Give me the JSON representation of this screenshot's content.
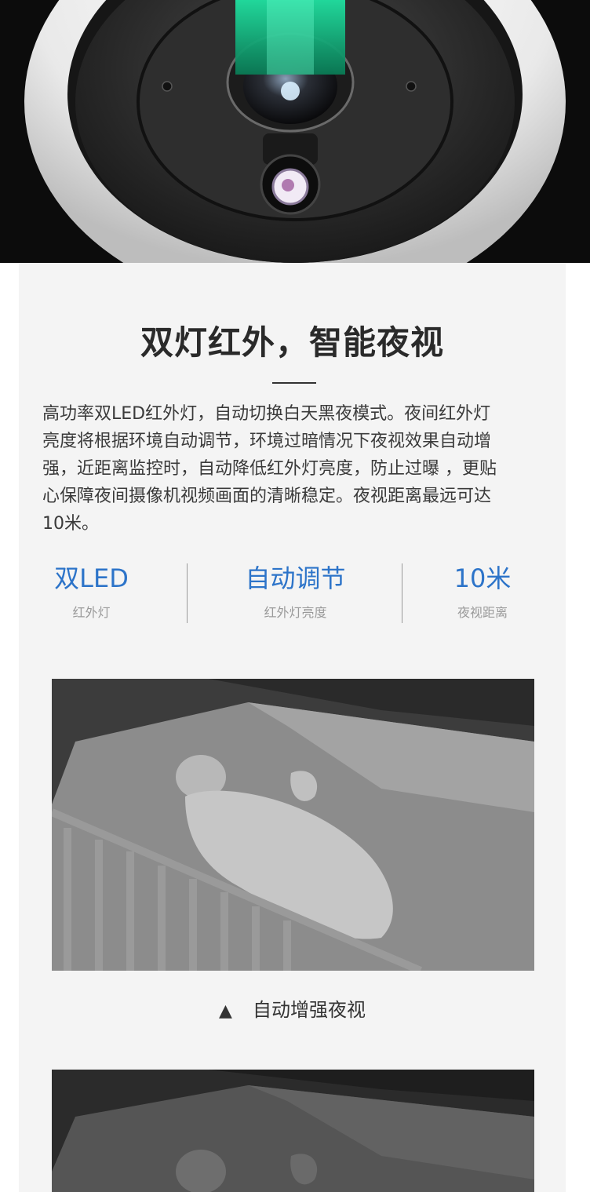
{
  "section": {
    "title": "双灯红外，智能夜视",
    "description_lines": [
      "高功率双LED红外灯，自动切换白天黑夜模式。夜间红外灯",
      "亮度将根据环境自动调节，环境过暗情况下夜视效果自动增",
      "强，近距离监控时，自动降低红外灯亮度，防止过曝 ，更贴",
      "心保障夜间摄像机视频画面的清晰稳定。夜视距离最远可达",
      "10米。"
    ]
  },
  "features": [
    {
      "value": "双LED",
      "label": "红外灯"
    },
    {
      "value": "自动调节",
      "label": "红外灯亮度"
    },
    {
      "value": "10米",
      "label": "夜视距离"
    }
  ],
  "caption": {
    "icon": "triangle-up-icon",
    "text": "自动增强夜视"
  },
  "colors": {
    "accent": "#2d74c9",
    "lens_glow": "#1fd49a",
    "panel_bg": "#f4f4f4"
  }
}
